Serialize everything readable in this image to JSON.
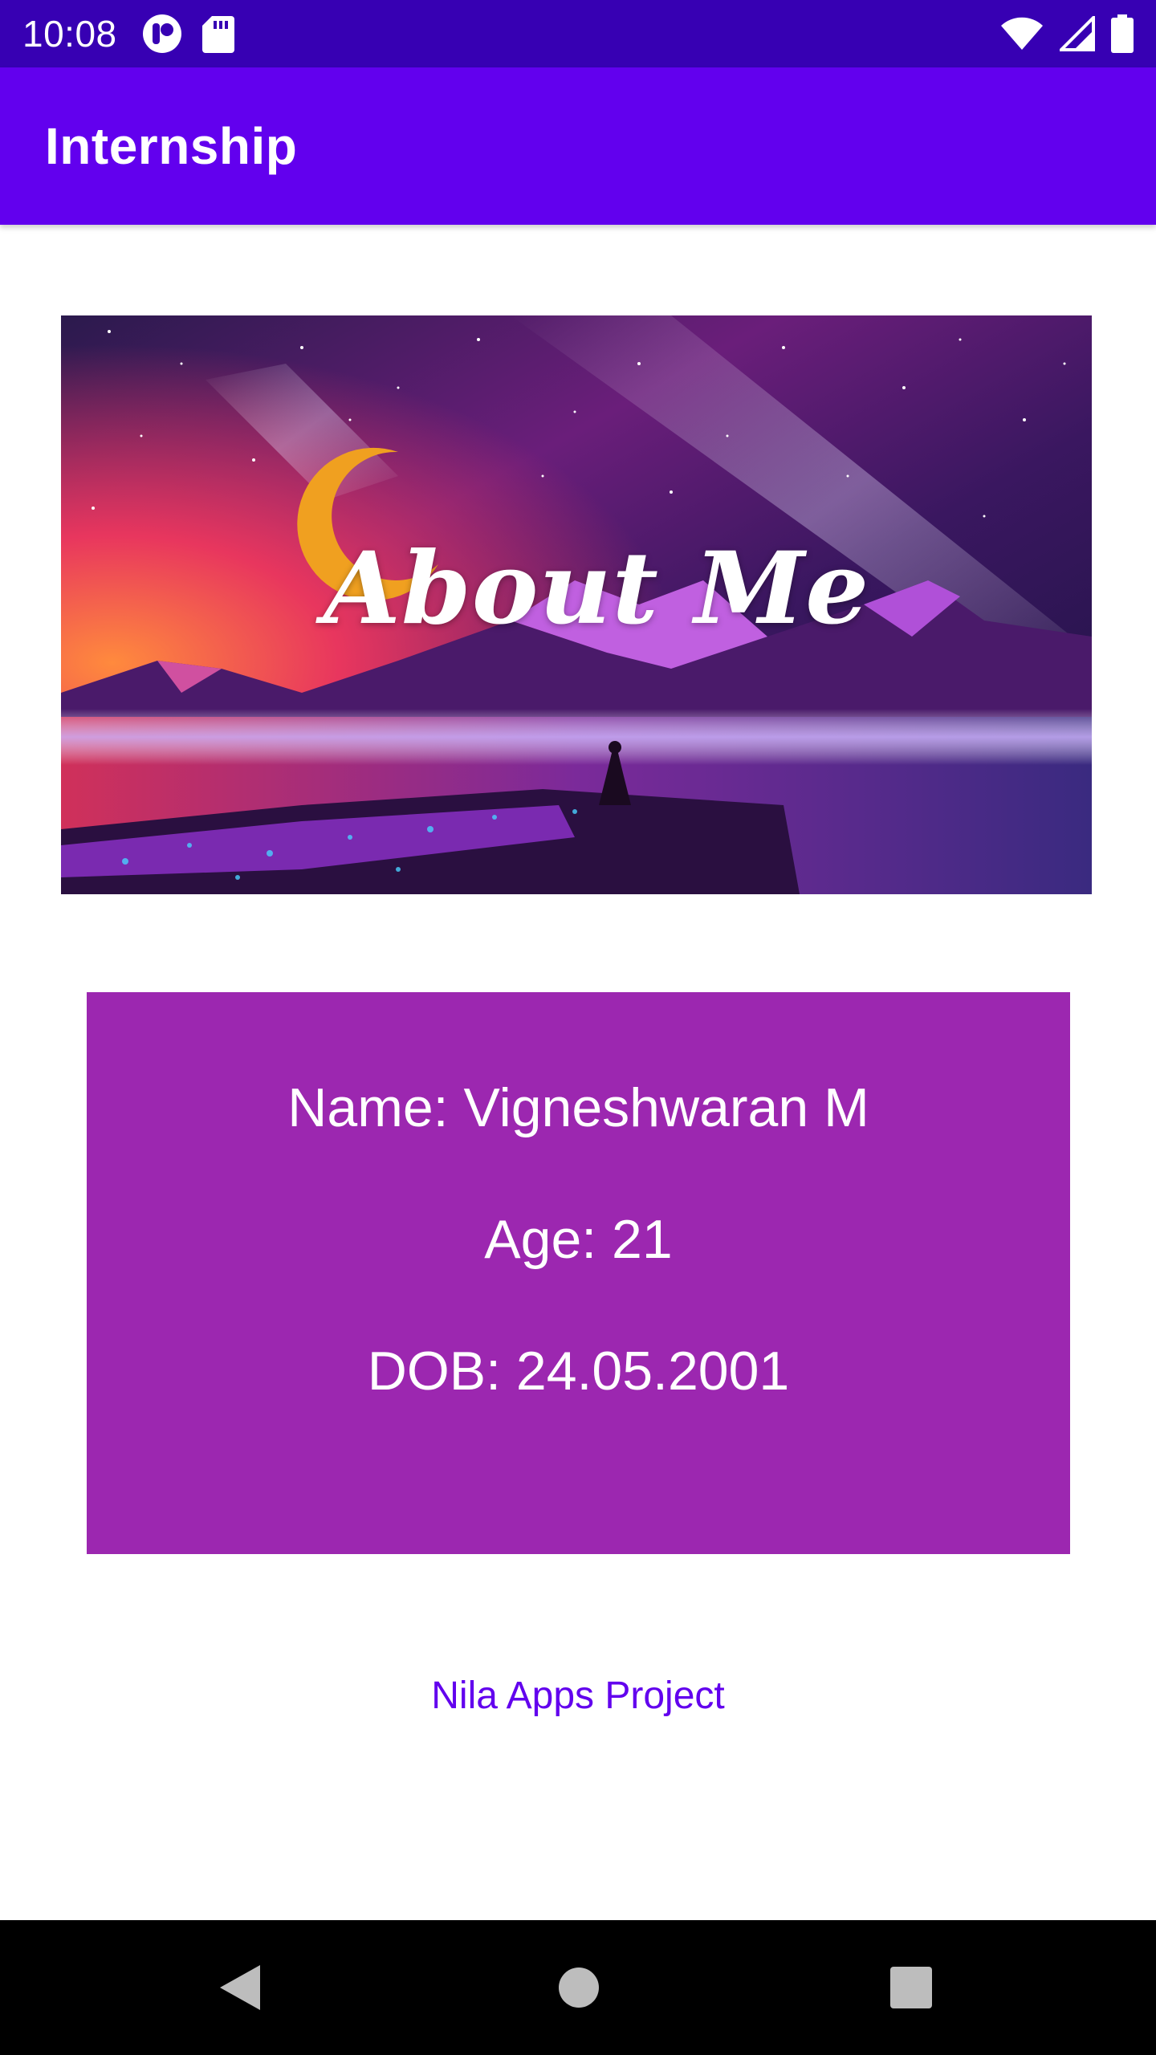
{
  "status_bar": {
    "time": "10:08",
    "left_icons": [
      "notification-app-icon",
      "sd-card-icon"
    ],
    "right_icons": [
      "wifi-icon",
      "cell-signal-icon",
      "battery-icon"
    ]
  },
  "app_bar": {
    "title": "Internship"
  },
  "banner": {
    "title": "About Me"
  },
  "info": {
    "name": "Name: Vigneshwaran M",
    "age": "Age: 21",
    "dob": "DOB: 24.05.2001"
  },
  "footer": {
    "link": "Nila Apps Project"
  },
  "nav_bar": {
    "buttons": [
      "back-icon",
      "home-icon",
      "recents-icon"
    ]
  },
  "colors": {
    "status_bar": "#3700b3",
    "app_bar": "#6200ee",
    "card": "#9c27b0",
    "link": "#6200ee"
  }
}
